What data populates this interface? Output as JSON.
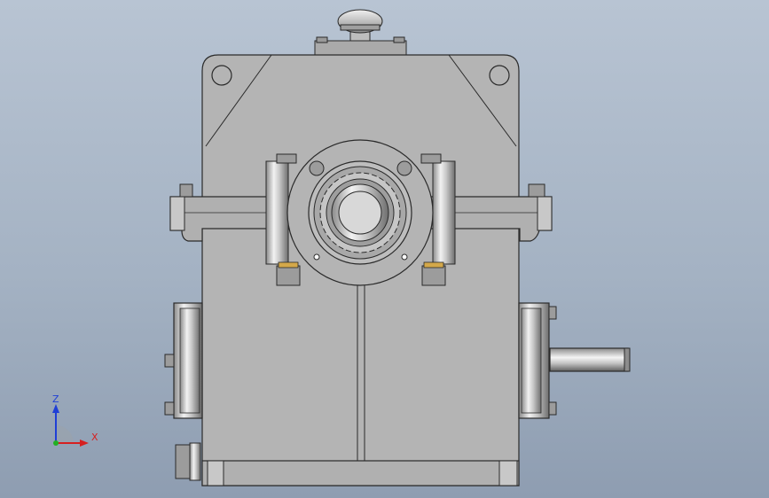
{
  "viewport": {
    "model_name": "",
    "colors": {
      "background_top": "#b8c4d3",
      "background_bottom": "#8e9db1",
      "housing": "#b4b4b4",
      "housing_dark": "#9c9c9c",
      "edge": "#2a2a2a"
    }
  },
  "triad": {
    "z_label": "Z",
    "x_label": "X",
    "colors": {
      "z": "#1f3fd6",
      "x": "#d62020",
      "y": "#22b022"
    }
  }
}
